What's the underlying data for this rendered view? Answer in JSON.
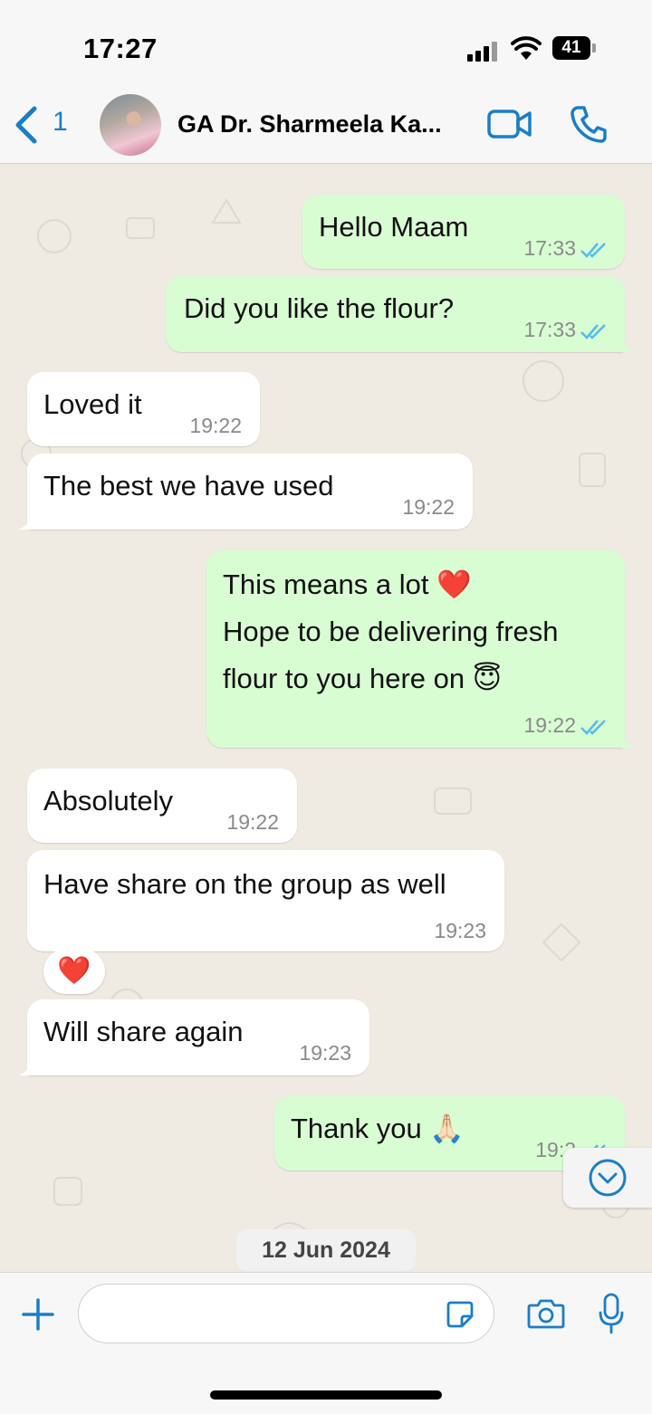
{
  "status_bar": {
    "time": "17:27",
    "battery": "41"
  },
  "header": {
    "back_count": "1",
    "contact_name": "GA Dr. Sharmeela Ka..."
  },
  "messages": [
    {
      "dir": "out",
      "lines": [
        "Hello Maam"
      ],
      "time": "17:33",
      "read": true
    },
    {
      "dir": "out",
      "lines": [
        "Did you like the flour?"
      ],
      "time": "17:33",
      "read": true
    },
    {
      "dir": "in",
      "lines": [
        "Loved it"
      ],
      "time": "19:22"
    },
    {
      "dir": "in",
      "lines": [
        "The best we have used"
      ],
      "time": "19:22"
    },
    {
      "dir": "out",
      "lines": [
        "This means a lot ❤️",
        "Hope to be delivering fresh",
        "flour to you here on 😇"
      ],
      "time": "19:22",
      "read": true
    },
    {
      "dir": "in",
      "lines": [
        "Absolutely"
      ],
      "time": "19:22"
    },
    {
      "dir": "in",
      "lines": [
        "Have share on the group as well"
      ],
      "time": "19:23"
    },
    {
      "dir": "in",
      "lines": [
        "Will share again"
      ],
      "time": "19:23"
    },
    {
      "dir": "out",
      "lines": [
        "Thank you 🙏🏻"
      ],
      "time": "19:2",
      "read": true
    }
  ],
  "reaction": "❤️",
  "date_chip": "12 Jun 2024",
  "input": {
    "value": "",
    "placeholder": ""
  },
  "colors": {
    "accent": "#1a7ec8",
    "outgoing_bubble": "#d9fdd3",
    "incoming_bubble": "#ffffff",
    "read_ticks": "#53bdeb",
    "chat_bg": "#efeae2"
  }
}
